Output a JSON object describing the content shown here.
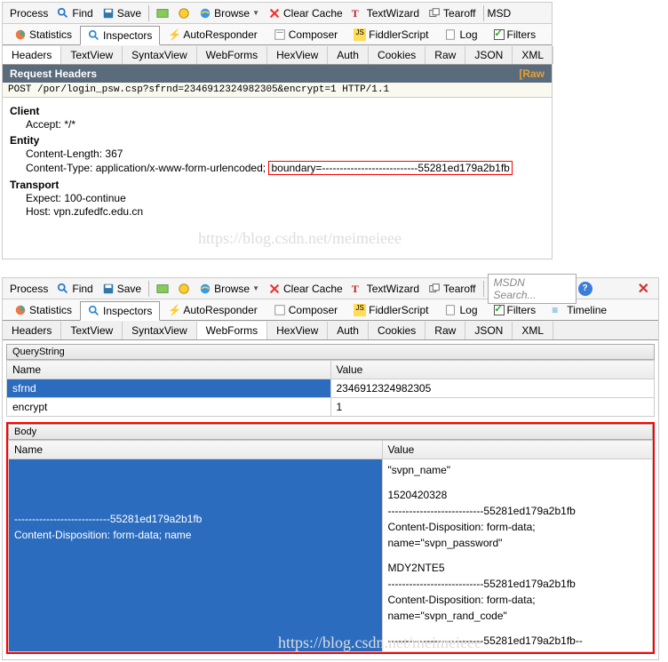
{
  "top": {
    "toolbar": {
      "process": "Process",
      "find": "Find",
      "save": "Save",
      "browse": "Browse",
      "clear_cache": "Clear Cache",
      "text_wizard": "TextWizard",
      "tearoff": "Tearoff",
      "msdn": "MSD"
    },
    "tabs": {
      "statistics": "Statistics",
      "inspectors": "Inspectors",
      "autoresponder": "AutoResponder",
      "composer": "Composer",
      "fiddlerscript": "FiddlerScript",
      "log": "Log",
      "filters": "Filters"
    },
    "subtabs": {
      "headers": "Headers",
      "textview": "TextView",
      "syntaxview": "SyntaxView",
      "webforms": "WebForms",
      "hexview": "HexView",
      "auth": "Auth",
      "cookies": "Cookies",
      "raw": "Raw",
      "json": "JSON",
      "xml": "XML"
    },
    "header_bar": {
      "title": "Request Headers",
      "raw": "[Raw"
    },
    "request_line": "POST /por/login_psw.csp?sfrnd=2346912324982305&encrypt=1 HTTP/1.1",
    "headers": {
      "client_group": "Client",
      "accept": "Accept: */*",
      "entity_group": "Entity",
      "content_length": "Content-Length: 367",
      "content_type_pre": "Content-Type: application/x-www-form-urlencoded;",
      "content_type_boxed": "boundary=---------------------------55281ed179a2b1fb",
      "transport_group": "Transport",
      "expect": "Expect: 100-continue",
      "host": "Host: vpn.zufedfc.edu.cn"
    },
    "watermark": "https://blog.csdn.net/meimeieee"
  },
  "bottom": {
    "toolbar": {
      "process": "Process",
      "find": "Find",
      "save": "Save",
      "browse": "Browse",
      "clear_cache": "Clear Cache",
      "text_wizard": "TextWizard",
      "tearoff": "Tearoff",
      "search_placeholder": "MSDN Search..."
    },
    "tabs": {
      "statistics": "Statistics",
      "inspectors": "Inspectors",
      "autoresponder": "AutoResponder",
      "composer": "Composer",
      "fiddlerscript": "FiddlerScript",
      "log": "Log",
      "filters": "Filters",
      "timeline": "Timeline"
    },
    "subtabs": {
      "headers": "Headers",
      "textview": "TextView",
      "syntaxview": "SyntaxView",
      "webforms": "WebForms",
      "hexview": "HexView",
      "auth": "Auth",
      "cookies": "Cookies",
      "raw": "Raw",
      "json": "JSON",
      "xml": "XML"
    },
    "querystring": {
      "title": "QueryString",
      "col_name": "Name",
      "col_value": "Value",
      "rows": [
        {
          "name": "sfrnd",
          "value": "2346912324982305"
        },
        {
          "name": "encrypt",
          "value": "1"
        }
      ]
    },
    "body": {
      "title": "Body",
      "col_name": "Name",
      "col_value": "Value",
      "name_cell_l1": "---------------------------55281ed179a2b1fb",
      "name_cell_l2": "Content-Disposition: form-data; name",
      "value_cell_l1": "\"svpn_name\"",
      "value_cell_l2": "1520420328",
      "value_cell_l3": "---------------------------55281ed179a2b1fb",
      "value_cell_l4": "Content-Disposition: form-data; name=\"svpn_password\"",
      "value_cell_l5": "MDY2NTE5",
      "value_cell_l6": "---------------------------55281ed179a2b1fb",
      "value_cell_l7": "Content-Disposition: form-data; name=\"svpn_rand_code\"",
      "value_cell_l8": "---------------------------55281ed179a2b1fb--"
    },
    "watermark": "https://blog.csdn.net/meimeieee"
  }
}
